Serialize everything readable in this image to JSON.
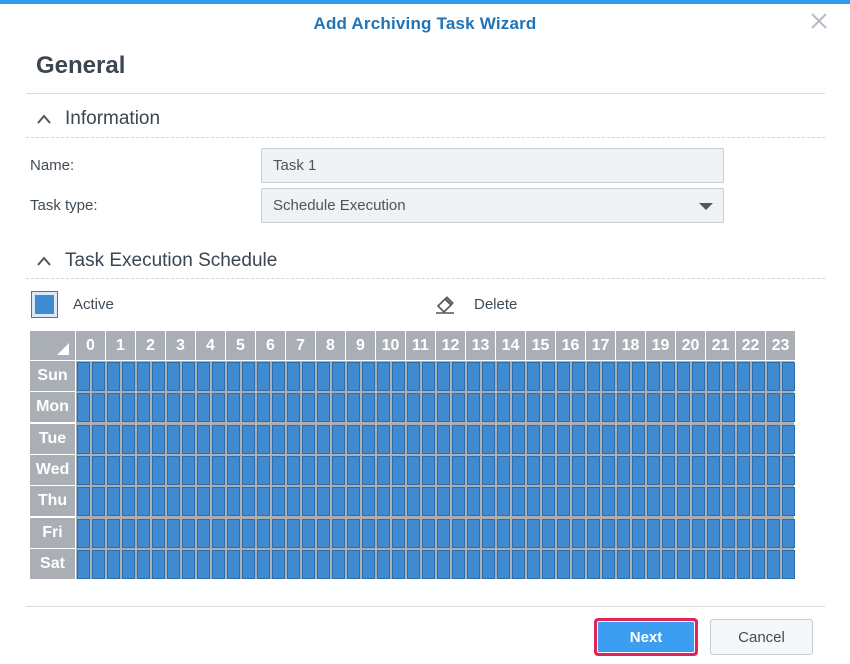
{
  "dialog": {
    "title": "Add Archiving Task Wizard",
    "close_icon": "close-icon",
    "accent_color": "#2e9ae8"
  },
  "page_heading": "General",
  "information": {
    "section_title": "Information",
    "name_label": "Name:",
    "name_value": "Task 1",
    "task_type_label": "Task type:",
    "task_type_value": "Schedule Execution"
  },
  "schedule": {
    "section_title": "Task Execution Schedule",
    "legend_active": "Active",
    "legend_delete": "Delete",
    "active_color": "#3f8ad0",
    "hours": [
      "0",
      "1",
      "2",
      "3",
      "4",
      "5",
      "6",
      "7",
      "8",
      "9",
      "10",
      "11",
      "12",
      "13",
      "14",
      "15",
      "16",
      "17",
      "18",
      "19",
      "20",
      "21",
      "22",
      "23"
    ],
    "days": [
      "Sun",
      "Mon",
      "Tue",
      "Wed",
      "Thu",
      "Fri",
      "Sat"
    ],
    "all_slots_active": true
  },
  "footer": {
    "next_label": "Next",
    "cancel_label": "Cancel",
    "highlight_color": "#e0245e"
  }
}
